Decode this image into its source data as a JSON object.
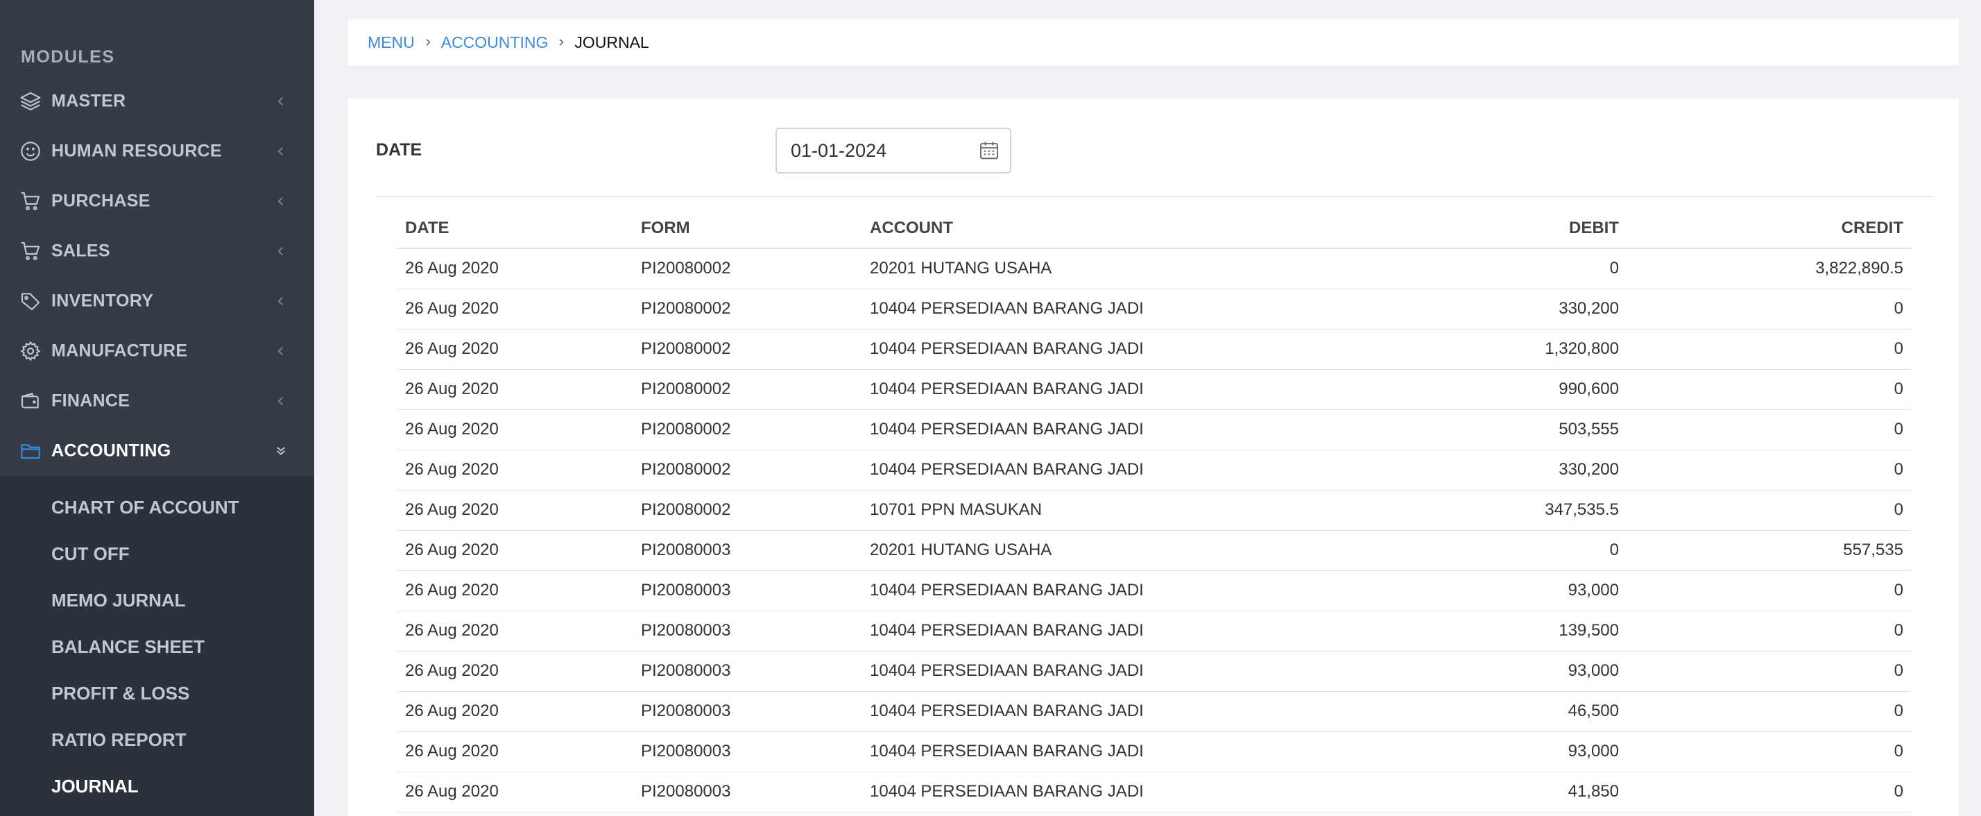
{
  "sidebar": {
    "title": "MODULES",
    "items": [
      {
        "label": "MASTER",
        "icon": "layers-icon"
      },
      {
        "label": "HUMAN RESOURCE",
        "icon": "smile-icon"
      },
      {
        "label": "PURCHASE",
        "icon": "cart-icon"
      },
      {
        "label": "SALES",
        "icon": "cart-icon"
      },
      {
        "label": "INVENTORY",
        "icon": "tag-icon"
      },
      {
        "label": "MANUFACTURE",
        "icon": "gear-icon"
      },
      {
        "label": "FINANCE",
        "icon": "wallet-icon"
      },
      {
        "label": "ACCOUNTING",
        "icon": "folder-icon"
      }
    ],
    "submenu": [
      {
        "label": "CHART OF ACCOUNT"
      },
      {
        "label": "CUT OFF"
      },
      {
        "label": "MEMO JURNAL"
      },
      {
        "label": "BALANCE SHEET"
      },
      {
        "label": "PROFIT & LOSS"
      },
      {
        "label": "RATIO REPORT"
      },
      {
        "label": "JOURNAL"
      }
    ],
    "active_item": "ACCOUNTING",
    "active_submenu": "JOURNAL",
    "accent_color": "#3b8ad9"
  },
  "breadcrumb": {
    "items": [
      "MENU",
      "ACCOUNTING"
    ],
    "current": "JOURNAL"
  },
  "filter": {
    "label": "DATE",
    "value": "01-01-2024"
  },
  "table": {
    "columns": [
      "DATE",
      "FORM",
      "ACCOUNT",
      "DEBIT",
      "CREDIT"
    ],
    "rows": [
      [
        "26 Aug 2020",
        "PI20080002",
        "20201 HUTANG USAHA",
        "0",
        "3,822,890.5"
      ],
      [
        "26 Aug 2020",
        "PI20080002",
        "10404 PERSEDIAAN BARANG JADI",
        "330,200",
        "0"
      ],
      [
        "26 Aug 2020",
        "PI20080002",
        "10404 PERSEDIAAN BARANG JADI",
        "1,320,800",
        "0"
      ],
      [
        "26 Aug 2020",
        "PI20080002",
        "10404 PERSEDIAAN BARANG JADI",
        "990,600",
        "0"
      ],
      [
        "26 Aug 2020",
        "PI20080002",
        "10404 PERSEDIAAN BARANG JADI",
        "503,555",
        "0"
      ],
      [
        "26 Aug 2020",
        "PI20080002",
        "10404 PERSEDIAAN BARANG JADI",
        "330,200",
        "0"
      ],
      [
        "26 Aug 2020",
        "PI20080002",
        "10701 PPN MASUKAN",
        "347,535.5",
        "0"
      ],
      [
        "26 Aug 2020",
        "PI20080003",
        "20201 HUTANG USAHA",
        "0",
        "557,535"
      ],
      [
        "26 Aug 2020",
        "PI20080003",
        "10404 PERSEDIAAN BARANG JADI",
        "93,000",
        "0"
      ],
      [
        "26 Aug 2020",
        "PI20080003",
        "10404 PERSEDIAAN BARANG JADI",
        "139,500",
        "0"
      ],
      [
        "26 Aug 2020",
        "PI20080003",
        "10404 PERSEDIAAN BARANG JADI",
        "93,000",
        "0"
      ],
      [
        "26 Aug 2020",
        "PI20080003",
        "10404 PERSEDIAAN BARANG JADI",
        "46,500",
        "0"
      ],
      [
        "26 Aug 2020",
        "PI20080003",
        "10404 PERSEDIAAN BARANG JADI",
        "93,000",
        "0"
      ],
      [
        "26 Aug 2020",
        "PI20080003",
        "10404 PERSEDIAAN BARANG JADI",
        "41,850",
        "0"
      ]
    ]
  }
}
